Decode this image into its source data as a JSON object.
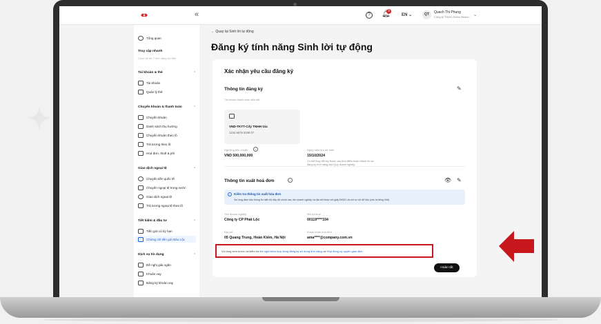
{
  "topbar": {
    "collapse_icon": "«",
    "help_icon": "?",
    "bell_icon": "bell-icon",
    "notification_count": "9",
    "language": "EN ⌄",
    "avatar_initials": "QT",
    "user_name": "Quach Thi Phung",
    "company_name": "Công ty TNHH Green Beach..."
  },
  "sidebar": {
    "overview": "Tổng quan",
    "quick_access": "Truy cập nhanh",
    "quick_access_hint": "Chọn tối đa 7 tính năng ưu tiên",
    "group_accounts": "Tài khoản & thẻ",
    "accounts_items": [
      "Tài khoản",
      "Quản lý thẻ"
    ],
    "group_transfers": "Chuyển khoản & thanh toán",
    "transfer_items": [
      "Chuyển khoản",
      "Danh sách thụ hưởng",
      "Chuyển khoản theo lô",
      "Trả lương theo lô",
      "Hoá đơn, thuế & phí"
    ],
    "group_fx": "Giao dịch ngoại tệ",
    "fx_items": [
      "Chuyển tiền quốc tế",
      "Chuyển ngoại tệ trong nước",
      "Giao dịch ngoại tệ",
      "Trả lương ngoại tệ theo lô"
    ],
    "group_savings": "Tiết kiệm & đầu tư",
    "savings_items": [
      "Tiền gửi có kỳ hạn",
      "Chứng chỉ tiền gửi Bảo Lộc"
    ],
    "group_credit": "Dịch vụ tín dụng",
    "credit_items": [
      "Đề nghị giải ngân",
      "Khoản vay",
      "Đăng ký khoản vay"
    ]
  },
  "main": {
    "back_link": "← Quay lại Sinh lời tự động",
    "page_title": "Đăng ký tính năng Sinh lời tự động"
  },
  "card": {
    "title": "Xác nhận yêu cầu đăng ký",
    "reg_section": "Thông tin đăng ký",
    "source_account_label": "Tài khoản thanh toán liên kết",
    "account_name": "VND-TKTT-City TNHH Gia",
    "account_number": "1234 5678 9198 07",
    "threshold_label": "Ngưỡng tiêu chuẩn",
    "threshold_value": "VND 500,000,000",
    "effective_date_label": "Ngày hiệu lực dự kiến",
    "effective_date": "15/10/2024",
    "effective_note_1": "Có thể thay đổi tùy thuộc vào thời điểm hoàn thành hồ sơ",
    "effective_note_2": "đăng ký tính năng của Quý doanh nghiệp",
    "invoice_section": "Thông tin xuất hoá đơn",
    "info_title": "Kiểm tra thông tin xuất hóa đơn",
    "info_body": "Vui lòng đảm bảo thông tin hiển thị đầy đủ chính xác, tên doanh nghiệp và địa chỉ khớp với giấy ĐKKD và với cơ sở dữ liệu (nếu là tiếng Việt)",
    "company_label": "Tên doanh nghiệp",
    "company_value": "Công ty CP Phát Lộc",
    "tax_label": "Mã số thuế",
    "tax_value": "00119****334",
    "address_label": "Địa chỉ",
    "address_value": "05 Quang Trung, Hoàn Kiếm, Hà Nội",
    "email_label": "Email nhận hóa đơn",
    "email_value": "ama****@company.com.vn",
    "terms_prefix": "Vui lòng xem trước và kiểm tra ",
    "terms_link_1": "Đề nghị kiêm hợp đồng đăng ký sử dụng tính năng",
    "terms_and": " và ",
    "terms_link_2": "Hợp đồng uỷ quyền giao dịch",
    "submit_button": "Hoàn tất"
  },
  "colors": {
    "brand_red": "#d7262a",
    "highlight_red": "#c8171c",
    "link_blue": "#1a5fd0",
    "info_bg": "#e6f1fc"
  }
}
